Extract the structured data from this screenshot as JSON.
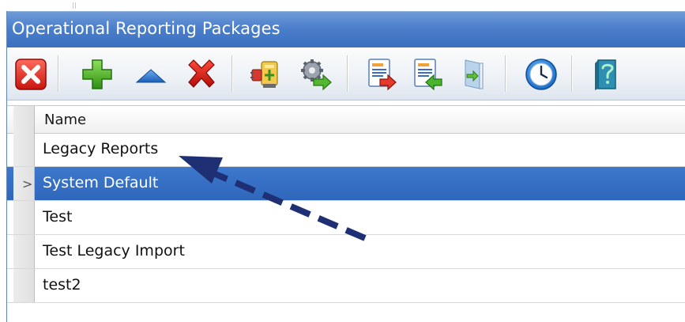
{
  "window": {
    "title": "Operational Reporting Packages"
  },
  "toolbar": {
    "buttons": [
      {
        "icon": "close-red-x-icon"
      },
      {
        "icon": "add-icon"
      },
      {
        "icon": "move-up-icon"
      },
      {
        "icon": "delete-icon"
      },
      {
        "icon": "plugin-icon"
      },
      {
        "icon": "gear-run-icon"
      },
      {
        "icon": "export-report-icon"
      },
      {
        "icon": "import-report-icon"
      },
      {
        "icon": "exit-door-icon"
      },
      {
        "icon": "schedule-clock-icon"
      },
      {
        "icon": "help-book-icon"
      }
    ]
  },
  "grid": {
    "columns": [
      {
        "label": "Name"
      }
    ],
    "rows": [
      {
        "name": "Legacy Reports",
        "selected": false
      },
      {
        "name": "System Default",
        "selected": true
      },
      {
        "name": "Test",
        "selected": false
      },
      {
        "name": "Test Legacy Import",
        "selected": false
      },
      {
        "name": "test2",
        "selected": false
      }
    ],
    "current_row_indicator": ">"
  },
  "colors": {
    "title_bar": "#4a7fcc",
    "selection": "#3470c4",
    "annotation_arrow": "#1e2f73"
  }
}
